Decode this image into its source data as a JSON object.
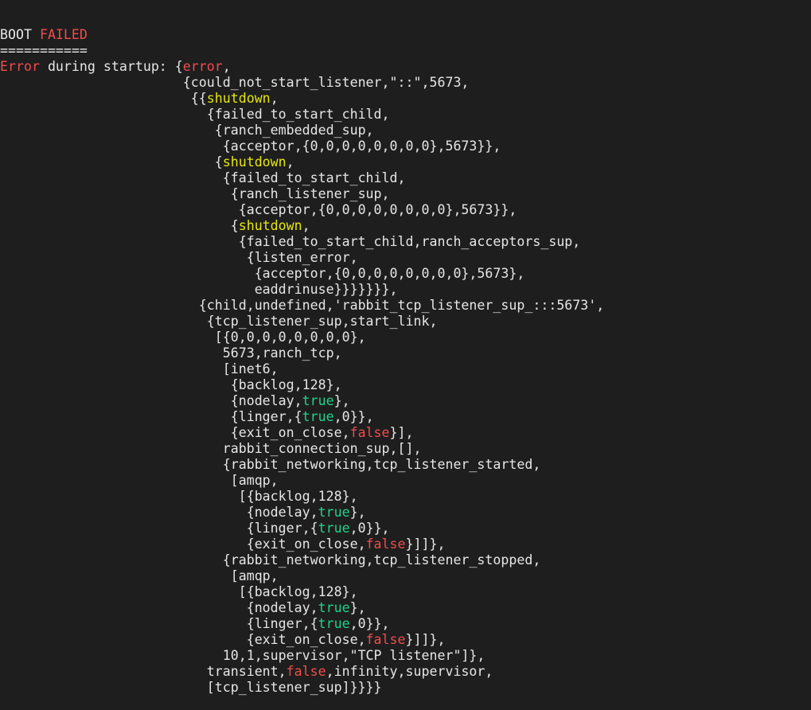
{
  "terminal": {
    "colors": {
      "background": "#1e1e1e",
      "text": "#e6e6e6",
      "red": "#f14c4c",
      "yellow": "#e5e510",
      "green": "#23d18b"
    },
    "lines": [
      [
        {
          "t": "BOOT ",
          "c": "default"
        },
        {
          "t": "FAILED",
          "c": "red"
        }
      ],
      [
        {
          "t": "===========",
          "c": "default"
        }
      ],
      [
        {
          "t": "Error",
          "c": "red"
        },
        {
          "t": " during startup: {",
          "c": "default"
        },
        {
          "t": "error",
          "c": "red"
        },
        {
          "t": ",",
          "c": "default"
        }
      ],
      [
        {
          "t": "                       {could_not_start_listener,\"::\",5673,",
          "c": "default"
        }
      ],
      [
        {
          "t": "                        {{",
          "c": "default"
        },
        {
          "t": "shutdown",
          "c": "yellow"
        },
        {
          "t": ",",
          "c": "default"
        }
      ],
      [
        {
          "t": "                          {failed_to_start_child,",
          "c": "default"
        }
      ],
      [
        {
          "t": "                           {ranch_embedded_sup,",
          "c": "default"
        }
      ],
      [
        {
          "t": "                            {acceptor,{0,0,0,0,0,0,0,0},5673}},",
          "c": "default"
        }
      ],
      [
        {
          "t": "                           {",
          "c": "default"
        },
        {
          "t": "shutdown",
          "c": "yellow"
        },
        {
          "t": ",",
          "c": "default"
        }
      ],
      [
        {
          "t": "                            {failed_to_start_child,",
          "c": "default"
        }
      ],
      [
        {
          "t": "                             {ranch_listener_sup,",
          "c": "default"
        }
      ],
      [
        {
          "t": "                              {acceptor,{0,0,0,0,0,0,0,0},5673}},",
          "c": "default"
        }
      ],
      [
        {
          "t": "                             {",
          "c": "default"
        },
        {
          "t": "shutdown",
          "c": "yellow"
        },
        {
          "t": ",",
          "c": "default"
        }
      ],
      [
        {
          "t": "                              {failed_to_start_child,ranch_acceptors_sup,",
          "c": "default"
        }
      ],
      [
        {
          "t": "                               {listen_error,",
          "c": "default"
        }
      ],
      [
        {
          "t": "                                {acceptor,{0,0,0,0,0,0,0,0},5673},",
          "c": "default"
        }
      ],
      [
        {
          "t": "                                eaddrinuse}}}}}}},",
          "c": "default"
        }
      ],
      [
        {
          "t": "                         {child,undefined,'rabbit_tcp_listener_sup_:::5673',",
          "c": "default"
        }
      ],
      [
        {
          "t": "                          {tcp_listener_sup,start_link,",
          "c": "default"
        }
      ],
      [
        {
          "t": "                           [{0,0,0,0,0,0,0,0},",
          "c": "default"
        }
      ],
      [
        {
          "t": "                            5673,ranch_tcp,",
          "c": "default"
        }
      ],
      [
        {
          "t": "                            [inet6,",
          "c": "default"
        }
      ],
      [
        {
          "t": "                             {backlog,128},",
          "c": "default"
        }
      ],
      [
        {
          "t": "                             {nodelay,",
          "c": "default"
        },
        {
          "t": "true",
          "c": "green"
        },
        {
          "t": "},",
          "c": "default"
        }
      ],
      [
        {
          "t": "                             {linger,{",
          "c": "default"
        },
        {
          "t": "true",
          "c": "green"
        },
        {
          "t": ",0}},",
          "c": "default"
        }
      ],
      [
        {
          "t": "                             {exit_on_close,",
          "c": "default"
        },
        {
          "t": "false",
          "c": "red"
        },
        {
          "t": "}],",
          "c": "default"
        }
      ],
      [
        {
          "t": "                            rabbit_connection_sup,[],",
          "c": "default"
        }
      ],
      [
        {
          "t": "                            {rabbit_networking,tcp_listener_started,",
          "c": "default"
        }
      ],
      [
        {
          "t": "                             [amqp,",
          "c": "default"
        }
      ],
      [
        {
          "t": "                              [{backlog,128},",
          "c": "default"
        }
      ],
      [
        {
          "t": "                               {nodelay,",
          "c": "default"
        },
        {
          "t": "true",
          "c": "green"
        },
        {
          "t": "},",
          "c": "default"
        }
      ],
      [
        {
          "t": "                               {linger,{",
          "c": "default"
        },
        {
          "t": "true",
          "c": "green"
        },
        {
          "t": ",0}},",
          "c": "default"
        }
      ],
      [
        {
          "t": "                               {exit_on_close,",
          "c": "default"
        },
        {
          "t": "false",
          "c": "red"
        },
        {
          "t": "}]]},",
          "c": "default"
        }
      ],
      [
        {
          "t": "                            {rabbit_networking,tcp_listener_stopped,",
          "c": "default"
        }
      ],
      [
        {
          "t": "                             [amqp,",
          "c": "default"
        }
      ],
      [
        {
          "t": "                              [{backlog,128},",
          "c": "default"
        }
      ],
      [
        {
          "t": "                               {nodelay,",
          "c": "default"
        },
        {
          "t": "true",
          "c": "green"
        },
        {
          "t": "},",
          "c": "default"
        }
      ],
      [
        {
          "t": "                               {linger,{",
          "c": "default"
        },
        {
          "t": "true",
          "c": "green"
        },
        {
          "t": ",0}},",
          "c": "default"
        }
      ],
      [
        {
          "t": "                               {exit_on_close,",
          "c": "default"
        },
        {
          "t": "false",
          "c": "red"
        },
        {
          "t": "}]]},",
          "c": "default"
        }
      ],
      [
        {
          "t": "                            10,1,supervisor,\"TCP listener\"]},",
          "c": "default"
        }
      ],
      [
        {
          "t": "                          transient,",
          "c": "default"
        },
        {
          "t": "false",
          "c": "red"
        },
        {
          "t": ",infinity,supervisor,",
          "c": "default"
        }
      ],
      [
        {
          "t": "                          [tcp_listener_sup]}}}}",
          "c": "default"
        }
      ]
    ]
  }
}
